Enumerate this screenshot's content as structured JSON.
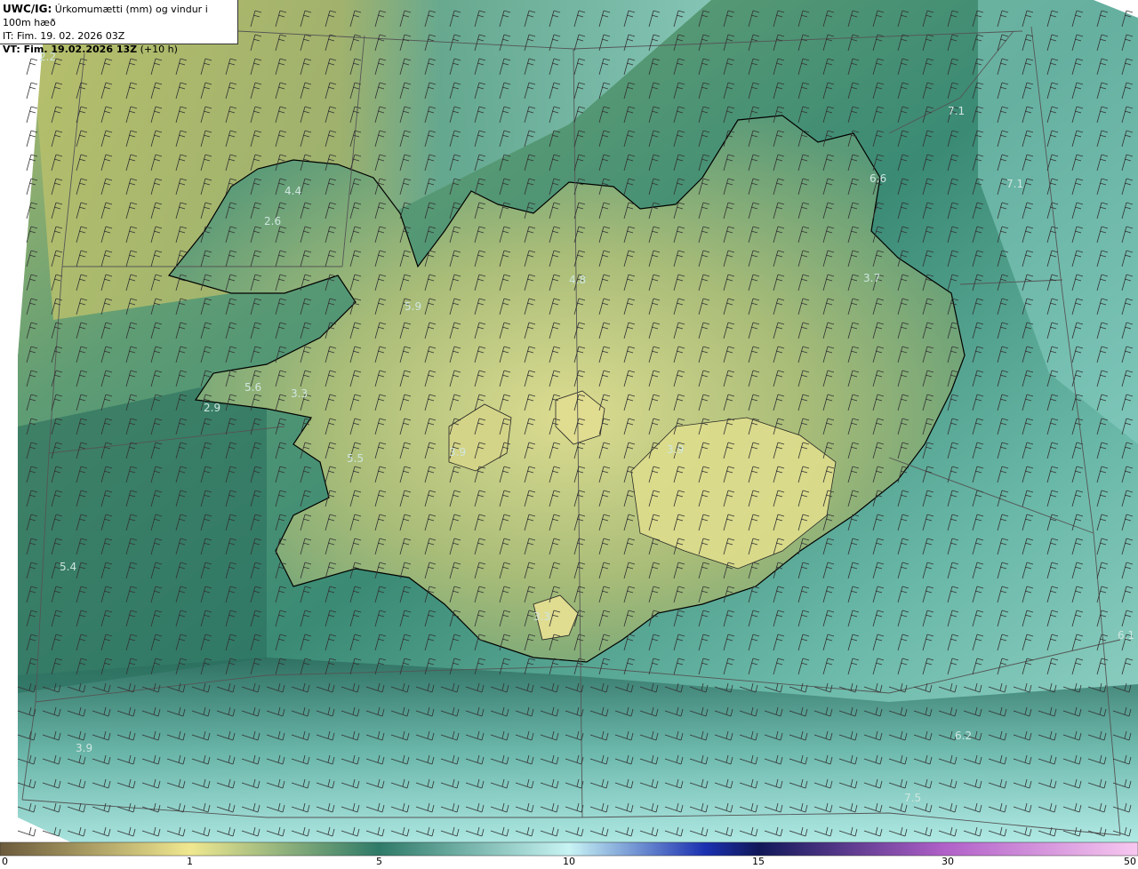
{
  "header": {
    "model": "UWC/IG:",
    "title": "Úrkomumætti (mm) og vindur i 100m hæð",
    "it_line": "IT: Fim. 19. 02. 2026 03Z",
    "vt_bold": "VT: Fim. 19.02.2026 13Z",
    "vt_suffix": "(+10 h)"
  },
  "colorbar": {
    "ticks": [
      "0",
      "1",
      "5",
      "10",
      "15",
      "30",
      "50"
    ],
    "stops": [
      "#6b5a3c",
      "#c8c070",
      "#f0e890",
      "#2e7a68",
      "#6cc0b4",
      "#c8f4f4",
      "#1020a0",
      "#102060",
      "#c070d0",
      "#f0b0e8"
    ]
  },
  "map_labels": [
    "2.2",
    "4.4",
    "2.6",
    "5.9",
    "4.8",
    "7.1",
    "7.1",
    "6.6",
    "3.7",
    "5.6",
    "3.3",
    "2.9",
    "5.5",
    "3.9",
    "5.4",
    "3.9",
    "3.3",
    "6.1",
    "6.2",
    "7.5",
    "3.9"
  ],
  "colors": {
    "ocean_light": "#a8e0d8",
    "ocean_dark": "#1e5e54",
    "land_yellow": "#d8dc8c",
    "land_green": "#8ab074",
    "grid": "#555555",
    "coast": "#000000",
    "barb": "#333333"
  }
}
